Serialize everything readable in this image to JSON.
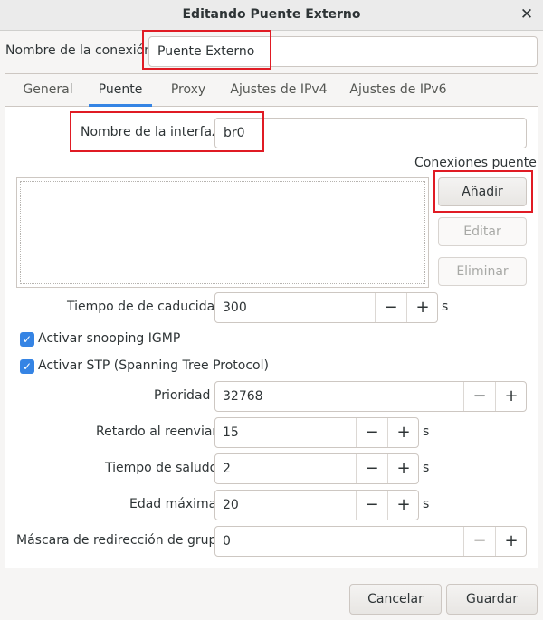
{
  "window": {
    "title": "Editando Puente Externo"
  },
  "connection": {
    "name_label": "Nombre de la conexión",
    "name_value": "Puente Externo"
  },
  "tabs": [
    {
      "label": "General"
    },
    {
      "label": "Puente"
    },
    {
      "label": "Proxy"
    },
    {
      "label": "Ajustes de IPv4"
    },
    {
      "label": "Ajustes de IPv6"
    }
  ],
  "active_tab": "Puente",
  "bridge": {
    "iface_label": "Nombre de la interfaz",
    "iface_value": "br0",
    "connections_label": "Conexiones puente",
    "buttons": {
      "add": "Añadir",
      "edit": "Editar",
      "delete": "Eliminar"
    },
    "aging": {
      "label": "Tiempo de de caducidad",
      "value": "300",
      "unit": "s"
    },
    "igmp": {
      "label": "Activar snooping IGMP",
      "checked": true
    },
    "stp": {
      "label": "Activar STP (Spanning Tree Protocol)",
      "checked": true
    },
    "priority": {
      "label": "Prioridad",
      "value": "32768"
    },
    "forward_delay": {
      "label": "Retardo al reenviar",
      "value": "15",
      "unit": "s"
    },
    "hello_time": {
      "label": "Tiempo de saludo",
      "value": "2",
      "unit": "s"
    },
    "max_age": {
      "label": "Edad máxima",
      "value": "20",
      "unit": "s"
    },
    "group_mask": {
      "label": "Máscara de redirección de grupo",
      "value": "0"
    }
  },
  "spin": {
    "minus": "−",
    "plus": "+"
  },
  "icons": {
    "close": "close-icon",
    "check": "checkmark-icon"
  },
  "footer": {
    "cancel": "Cancelar",
    "save": "Guardar"
  },
  "colors": {
    "accent": "#3584e4",
    "highlight": "#e01b24"
  }
}
